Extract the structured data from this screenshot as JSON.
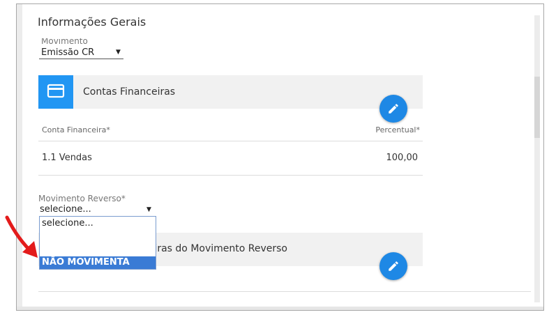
{
  "section": {
    "title": "Informações Gerais"
  },
  "movimento": {
    "label": "Movimento",
    "value": "Emissão CR"
  },
  "contas_card": {
    "title": "Contas Financeiras"
  },
  "table": {
    "headers": [
      "Conta Financeira*",
      "Percentual*"
    ],
    "rows": [
      {
        "conta": "1.1 Vendas",
        "percentual": "100,00"
      }
    ]
  },
  "movimento_reverso": {
    "label": "Movimento Reverso*",
    "value": "selecione...",
    "options": [
      "selecione...",
      "NÃO MOVIMENTA CAIXA"
    ]
  },
  "contas_reverso_card": {
    "title_visible": "iras do Movimento Reverso"
  },
  "colors": {
    "accent": "#2196f3",
    "fab": "#1e88e5",
    "highlight": "#3a7bd5",
    "annotation": "#e31b1b"
  },
  "icons": [
    "credit-card-icon",
    "pencil-icon",
    "caret-down-icon",
    "red-arrow-annotation"
  ]
}
